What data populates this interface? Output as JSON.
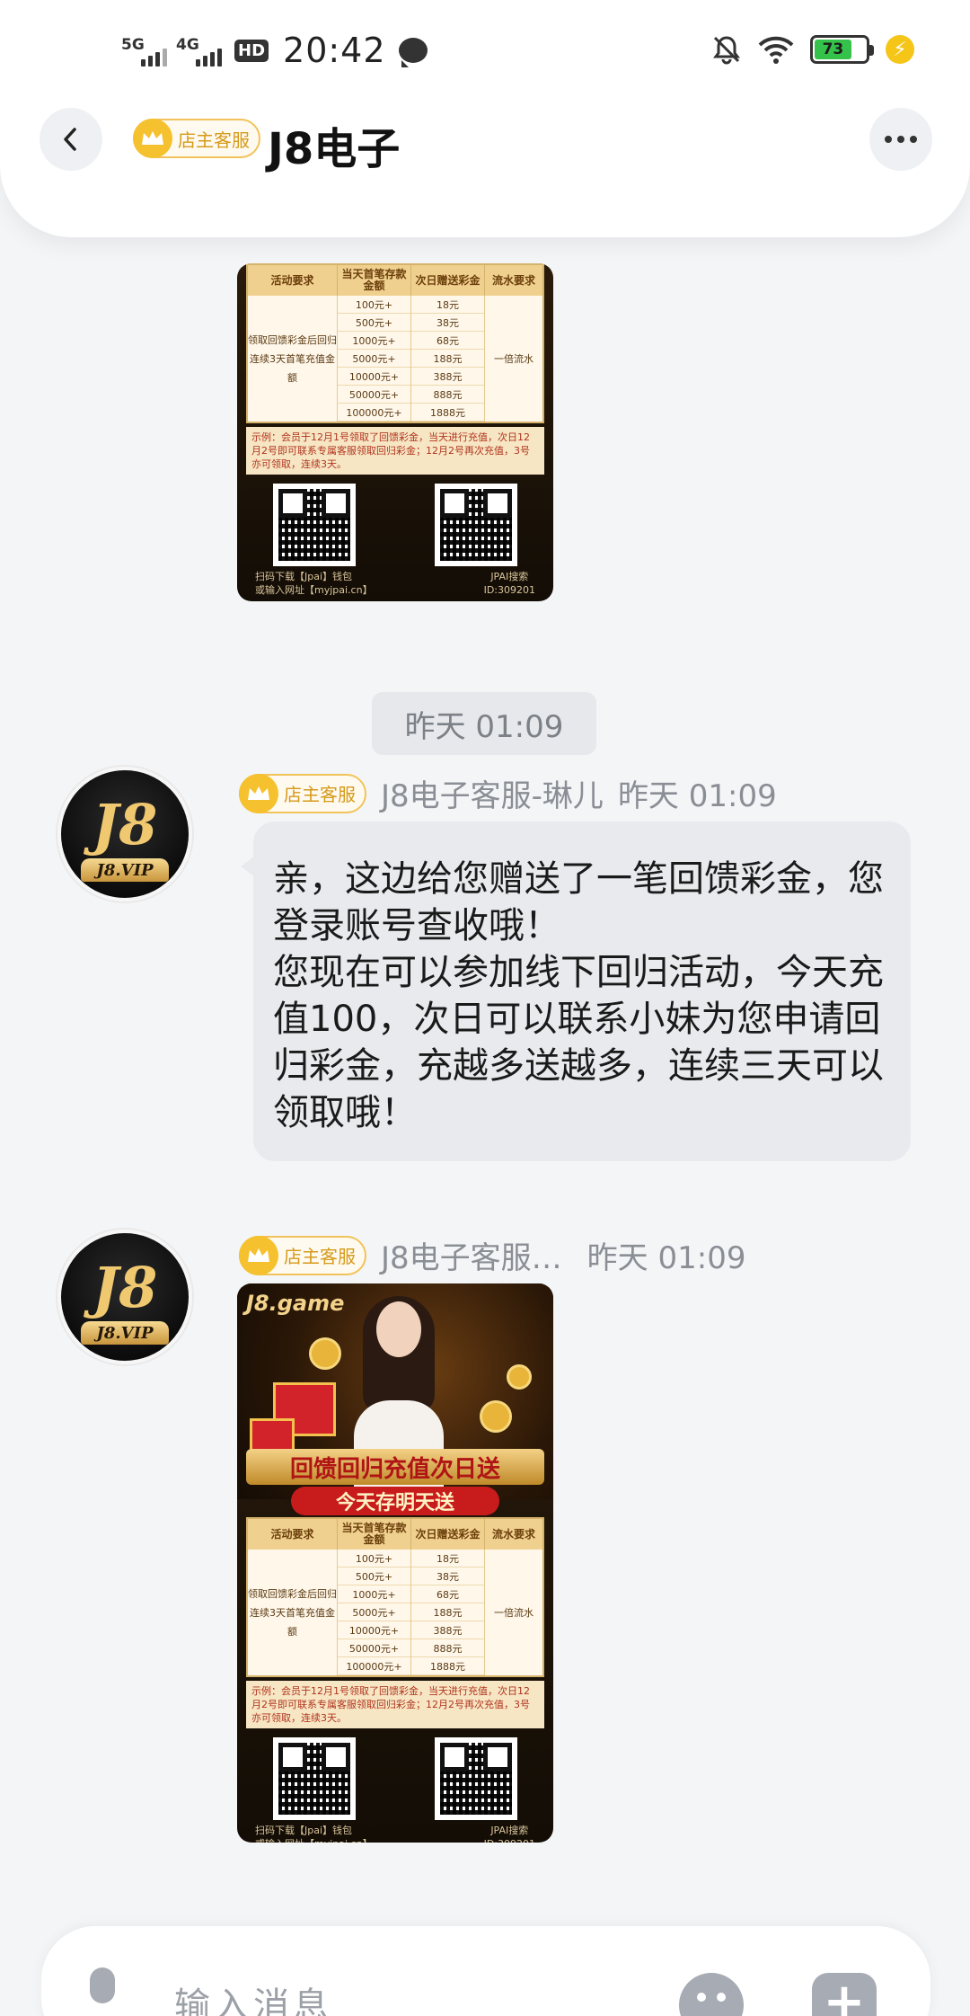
{
  "status_bar": {
    "net1": "5G",
    "net2": "4G",
    "hd": "HD",
    "time": "20:42",
    "battery": "73"
  },
  "header": {
    "badge_label": "店主客服",
    "title": "J8电子"
  },
  "poster": {
    "logo": "J8.game",
    "banner_main": "回馈回归充值次日送",
    "banner_sub": "今天存明天送",
    "table_headers": [
      "活动要求",
      "当天首笔存款金额",
      "次日赠送彩金",
      "流水要求"
    ],
    "requirement": "领取回馈彩金后回归连续3天首笔充值金额",
    "deposits": [
      "100元+",
      "500元+",
      "1000元+",
      "5000元+",
      "10000元+",
      "50000元+",
      "100000元+"
    ],
    "bonuses": [
      "18元",
      "38元",
      "68元",
      "188元",
      "388元",
      "888元",
      "1888元"
    ],
    "turnover": "一倍流水",
    "note": "示例：会员于12月1号领取了回馈彩金，当天进行充值，次日12月2号即可联系专属客服领取回归彩金；12月2号再次充值，3号亦可领取，连续3天。",
    "qr_left_label1": "扫码下载【Jpai】钱包",
    "qr_left_label2": "或输入网址【myjpai.cn】",
    "qr_right_label1": "JPAI搜索",
    "qr_right_label2": "ID:309201"
  },
  "divider": {
    "time": "昨天 01:09"
  },
  "messages": [
    {
      "badge_label": "店主客服",
      "sender": "J8电子客服-琳儿",
      "time": "昨天 01:09",
      "avatar_logo": "J8",
      "avatar_vip": "J8.VIP",
      "text": "亲，这边给您赠送了一笔回馈彩金，您登录账号查收哦！\n您现在可以参加线下回归活动，今天充值100，次日可以联系小妹为您申请回归彩金，充越多送越多，连续三天可以领取哦！"
    },
    {
      "badge_label": "店主客服",
      "sender": "J8电子客服…",
      "time": "昨天 01:09",
      "avatar_logo": "J8",
      "avatar_vip": "J8.VIP"
    }
  ],
  "input": {
    "placeholder": "输入消息"
  },
  "icons": {
    "back": "chevron-left-icon",
    "more": "more-dots-icon",
    "crown": "crown-icon",
    "mic": "microphone-icon",
    "emoji": "emoji-icon",
    "plus": "plus-icon"
  },
  "colors": {
    "badge_gold": "#f5c12e",
    "bubble": "#e8eaee",
    "battery": "#35c24a"
  }
}
